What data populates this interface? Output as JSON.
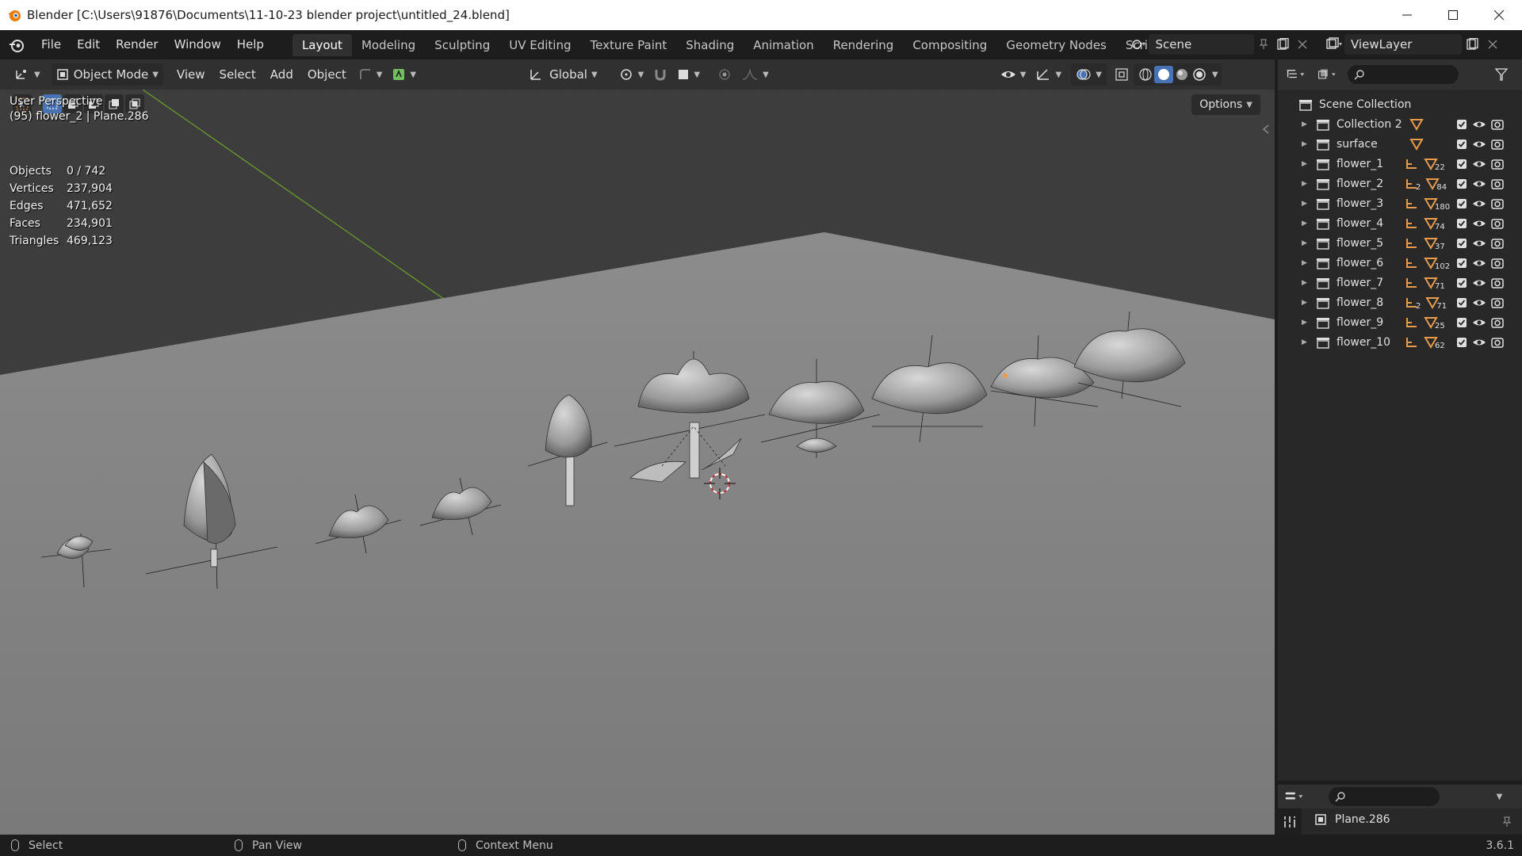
{
  "window": {
    "title": "Blender [C:\\Users\\91876\\Documents\\11-10-23 blender project\\untitled_24.blend]"
  },
  "menu": {
    "items": [
      "File",
      "Edit",
      "Render",
      "Window",
      "Help"
    ]
  },
  "workspaces": {
    "tabs": [
      "Layout",
      "Modeling",
      "Sculpting",
      "UV Editing",
      "Texture Paint",
      "Shading",
      "Animation",
      "Rendering",
      "Compositing",
      "Geometry Nodes",
      "Scripting"
    ],
    "active": "Layout",
    "add_label": "+"
  },
  "scene": {
    "name": "Scene"
  },
  "view_layer": {
    "name": "ViewLayer"
  },
  "viewport_header": {
    "mode": "Object Mode",
    "menus": [
      "View",
      "Select",
      "Add",
      "Object"
    ],
    "orientation": "Global"
  },
  "viewport": {
    "options_label": "Options",
    "perspective": "User Perspective",
    "context": "(95) flower_2 | Plane.286",
    "stats": [
      {
        "label": "Objects",
        "value": "0 / 742"
      },
      {
        "label": "Vertices",
        "value": "237,904"
      },
      {
        "label": "Edges",
        "value": "471,652"
      },
      {
        "label": "Faces",
        "value": "234,901"
      },
      {
        "label": "Triangles",
        "value": "469,123"
      }
    ]
  },
  "outliner": {
    "root": "Scene Collection",
    "items": [
      {
        "name": "Collection 2",
        "armature": false,
        "arm_count": "",
        "mesh_count": ""
      },
      {
        "name": "surface",
        "armature": false,
        "arm_count": "",
        "mesh_count": ""
      },
      {
        "name": "flower_1",
        "armature": true,
        "arm_count": "",
        "mesh_count": "22"
      },
      {
        "name": "flower_2",
        "armature": true,
        "arm_count": "2",
        "mesh_count": "84"
      },
      {
        "name": "flower_3",
        "armature": true,
        "arm_count": "",
        "mesh_count": "180"
      },
      {
        "name": "flower_4",
        "armature": true,
        "arm_count": "",
        "mesh_count": "74"
      },
      {
        "name": "flower_5",
        "armature": true,
        "arm_count": "",
        "mesh_count": "37"
      },
      {
        "name": "flower_6",
        "armature": true,
        "arm_count": "",
        "mesh_count": "102"
      },
      {
        "name": "flower_7",
        "armature": true,
        "arm_count": "",
        "mesh_count": "71"
      },
      {
        "name": "flower_8",
        "armature": true,
        "arm_count": "2",
        "mesh_count": "71"
      },
      {
        "name": "flower_9",
        "armature": true,
        "arm_count": "",
        "mesh_count": "25"
      },
      {
        "name": "flower_10",
        "armature": true,
        "arm_count": "",
        "mesh_count": "62"
      }
    ]
  },
  "properties": {
    "object_name": "Plane.286"
  },
  "statusbar": {
    "select": "Select",
    "pan": "Pan View",
    "context": "Context Menu",
    "version": "3.6.1"
  },
  "colors": {
    "accent": "#4772b3",
    "object_orange": "#e89b4a",
    "x_axis": "#b8343c",
    "y_axis": "#6b9a2a"
  }
}
